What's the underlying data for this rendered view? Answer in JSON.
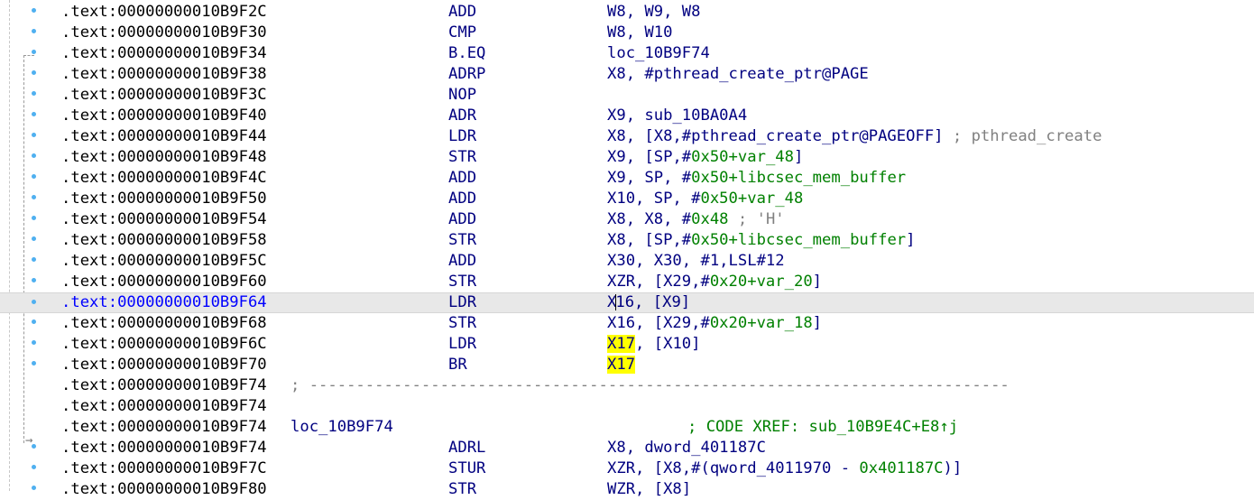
{
  "lines": [
    {
      "addr": ".text:00000000010B9F2C",
      "mnem": "ADD",
      "ops": "W8, W9, W8"
    },
    {
      "addr": ".text:00000000010B9F30",
      "mnem": "CMP",
      "ops": "W8, W10"
    },
    {
      "addr": ".text:00000000010B9F34",
      "mnem": "B.EQ",
      "ops": "loc_10B9F74"
    },
    {
      "addr": ".text:00000000010B9F38",
      "mnem": "ADRP",
      "ops": "X8, #pthread_create_ptr@PAGE"
    },
    {
      "addr": ".text:00000000010B9F3C",
      "mnem": "NOP",
      "ops": ""
    },
    {
      "addr": ".text:00000000010B9F40",
      "mnem": "ADR",
      "ops": "X9, sub_10BA0A4"
    },
    {
      "addr": ".text:00000000010B9F44",
      "mnem": "LDR",
      "ops": "X8, [X8,#pthread_create_ptr@PAGEOFF]",
      "comment": " ; pthread_create"
    },
    {
      "addr": ".text:00000000010B9F48",
      "mnem": "STR",
      "ops_pre": "X9, [SP,#",
      "ops_num": "0x50",
      "ops_sym": "+var_48",
      "ops_post": "]"
    },
    {
      "addr": ".text:00000000010B9F4C",
      "mnem": "ADD",
      "ops_pre": "X9, SP, #",
      "ops_num": "0x50",
      "ops_sym": "+libcsec_mem_buffer",
      "ops_post": ""
    },
    {
      "addr": ".text:00000000010B9F50",
      "mnem": "ADD",
      "ops_pre": "X10, SP, #",
      "ops_num": "0x50",
      "ops_sym": "+var_48",
      "ops_post": ""
    },
    {
      "addr": ".text:00000000010B9F54",
      "mnem": "ADD",
      "ops_pre": "X8, X8, #",
      "ops_num": "0x48",
      "ops_sym": "",
      "ops_post": "",
      "comment": " ; 'H'"
    },
    {
      "addr": ".text:00000000010B9F58",
      "mnem": "STR",
      "ops_pre": "X8, [SP,#",
      "ops_num": "0x50",
      "ops_sym": "+libcsec_mem_buffer",
      "ops_post": "]"
    },
    {
      "addr": ".text:00000000010B9F5C",
      "mnem": "ADD",
      "ops": "X30, X30, #1,LSL#12"
    },
    {
      "addr": ".text:00000000010B9F60",
      "mnem": "STR",
      "ops_pre": "XZR, [X29,#",
      "ops_num": "0x20",
      "ops_sym": "+var_20",
      "ops_post": "]"
    },
    {
      "addr": ".text:00000000010B9F64",
      "mnem": "LDR",
      "ops": "X16, [X9]"
    },
    {
      "addr": ".text:00000000010B9F68",
      "mnem": "STR",
      "ops_pre": "X16, [X29,#",
      "ops_num": "0x20",
      "ops_sym": "+var_18",
      "ops_post": "]"
    },
    {
      "addr": ".text:00000000010B9F6C",
      "mnem": "LDR",
      "ops_hl": "X17",
      "ops_rest": ", [X10]"
    },
    {
      "addr": ".text:00000000010B9F70",
      "mnem": "BR",
      "ops_hl": "X17",
      "ops_rest": ""
    },
    {
      "addr": ".text:00000000010B9F74",
      "separator": "; ---------------------------------------------------------------------------"
    },
    {
      "addr": ".text:00000000010B9F74"
    },
    {
      "addr": ".text:00000000010B9F74",
      "label": "loc_10B9F74",
      "xref": "; CODE XREF: sub_10B9E4C+E8↑j"
    },
    {
      "addr": ".text:00000000010B9F74",
      "mnem": "ADRL",
      "ops": "X8, dword_401187C"
    },
    {
      "addr": ".text:00000000010B9F7C",
      "mnem": "STUR",
      "ops_pre": "XZR, [X8,#(qword_4011970 - ",
      "ops_num": "0x401187C",
      "ops_sym": "",
      "ops_post": ")]"
    },
    {
      "addr": ".text:00000000010B9F80",
      "mnem": "STR",
      "ops": "WZR, [X8]"
    }
  ]
}
